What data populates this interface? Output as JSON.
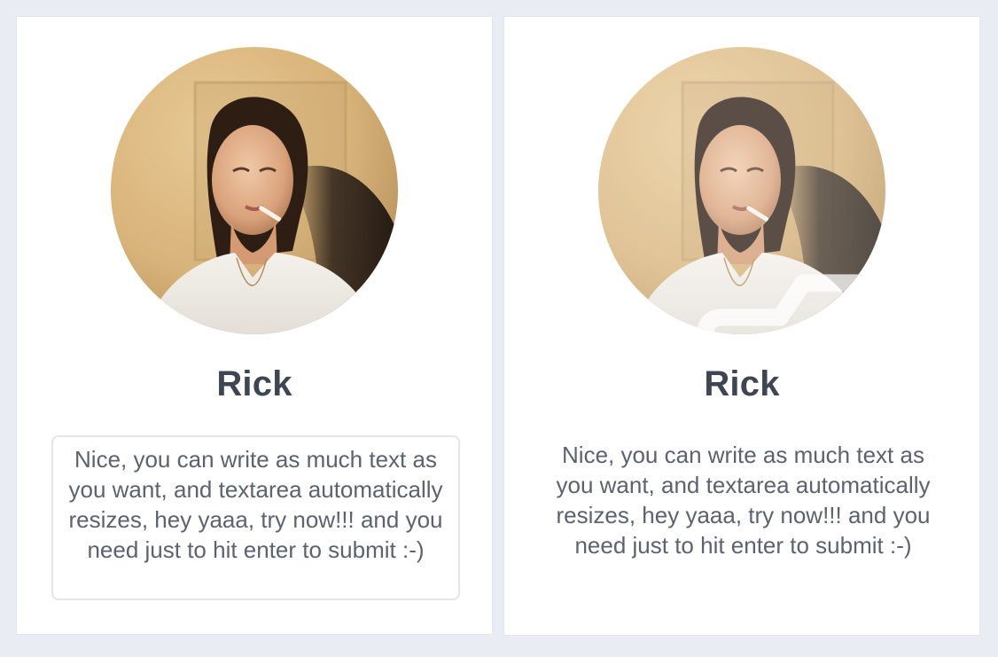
{
  "cards": [
    {
      "name": "Rick",
      "bio": "Nice, you can write as much text as you want, and textarea automatically resizes, hey yaaa, try now!!! and you need just to hit enter to submit :-)",
      "mode": "editing"
    },
    {
      "name": "Rick",
      "bio": "Nice, you can write as much text as you want, and textarea automatically resizes, hey yaaa, try now!!! and you need just to hit enter to submit :-)",
      "mode": "hover-avatar",
      "avatar_overlay_icon": "camera-icon"
    }
  ],
  "colors": {
    "page_background": "#e9ecf3",
    "card_background": "#ffffff",
    "name_text": "#3e4553",
    "bio_text": "#5b6270",
    "textarea_border": "#e3e5ea"
  }
}
